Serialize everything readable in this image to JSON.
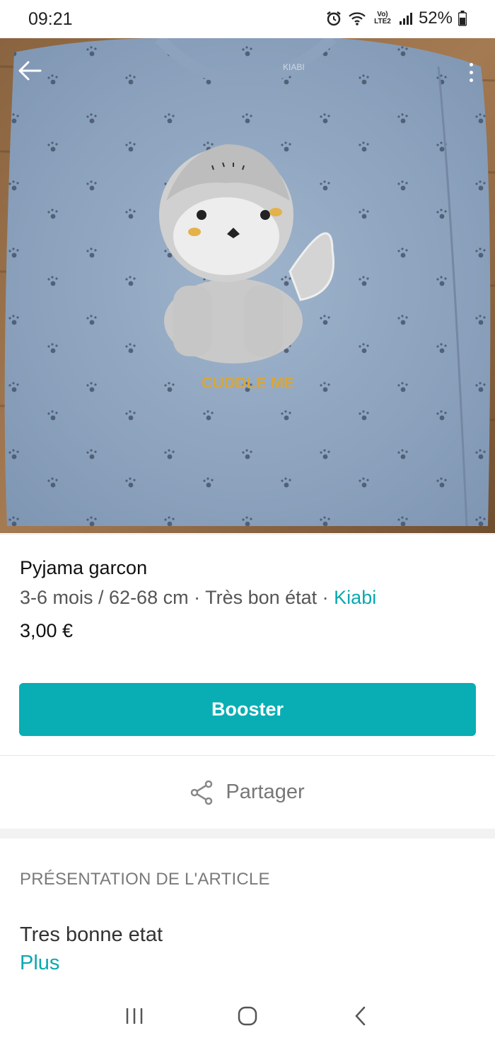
{
  "status_bar": {
    "time": "09:21",
    "battery": "52%",
    "network_label": "Vo) LTE2",
    "icons": [
      "alarm-icon",
      "wifi-icon",
      "signal-icon",
      "battery-icon"
    ]
  },
  "photo": {
    "print_text": "CUDDLE ME",
    "tag_text": "KIABI"
  },
  "item": {
    "title": "Pyjama garcon",
    "meta": "3-6 mois / 62-68 cm · Très bon état · ",
    "brand": "Kiabi",
    "price": "3,00 €"
  },
  "actions": {
    "booster_label": "Booster",
    "share_label": "Partager"
  },
  "description": {
    "heading": "PRÉSENTATION DE L'ARTICLE",
    "text": "Tres bonne etat",
    "more_label": "Plus"
  },
  "colors": {
    "accent": "#09aeb4",
    "brand_link": "#09a8b0"
  }
}
